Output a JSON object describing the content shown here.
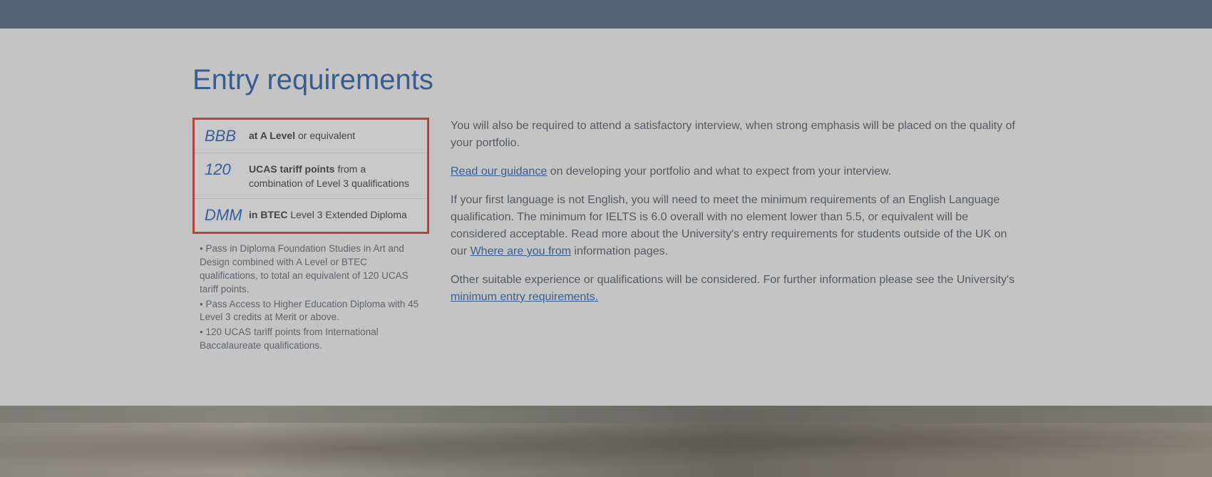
{
  "heading": "Entry requirements",
  "requirements": [
    {
      "code": "BBB",
      "bold": "at A Level",
      "rest": " or equivalent"
    },
    {
      "code": "120",
      "bold": "UCAS tariff points",
      "rest": " from a combination of Level 3 qualifications"
    },
    {
      "code": "DMM",
      "bold": "in BTEC",
      "rest": " Level 3 Extended Diploma"
    }
  ],
  "bullets": [
    "• Pass in Diploma Foundation Studies in Art and Design combined with A Level or BTEC qualifications, to total an equivalent of 120 UCAS tariff points.",
    "• Pass Access to Higher Education Diploma with 45 Level 3 credits at Merit or above.",
    "• 120 UCAS tariff points from International Baccalaureate qualifications."
  ],
  "body": {
    "p1": "You will also be required to attend a satisfactory interview, when strong emphasis will be placed on the quality of your portfolio.",
    "p2_link": "Read our guidance",
    "p2_rest": " on developing your portfolio and what to expect from your interview.",
    "p3_a": "If your first language is not English, you will need to meet the minimum requirements of an English Language qualification. The minimum for IELTS is 6.0 overall with no element lower than 5.5, or equivalent will be considered acceptable. Read more about the University's entry requirements for students outside of the UK on our ",
    "p3_link": "Where are you from",
    "p3_b": " information pages.",
    "p4_a": "Other suitable experience or qualifications will be considered. For further information please see the University's ",
    "p4_link": "minimum entry requirements."
  }
}
